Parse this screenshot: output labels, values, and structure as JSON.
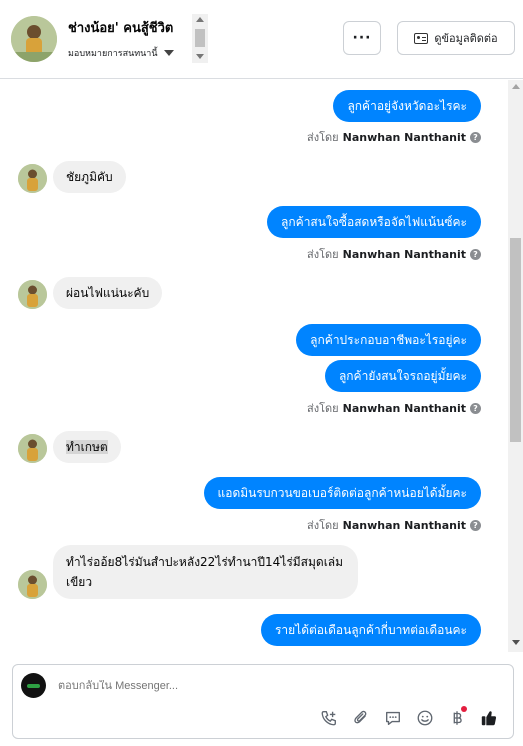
{
  "header": {
    "contact_name": "ช่างน้อย' คนสู้ชีวิต",
    "assign_label": "มอบหมายการสนทนานี้",
    "more_label": "···",
    "view_contact_label": "ดูข้อมูลติดต่อ"
  },
  "messages": [
    {
      "type": "out",
      "text": "ลูกค้าอยู่จังหวัดอะไรคะ"
    },
    {
      "type": "sent_by",
      "prefix": "ส่งโดย",
      "name": "Nanwhan Nanthanit"
    },
    {
      "type": "in",
      "text": "ชัยภูมิคับ"
    },
    {
      "type": "out",
      "text": "ลูกค้าสนใจซื้อสดหรือจัดไฟแน้นซ์คะ"
    },
    {
      "type": "sent_by",
      "prefix": "ส่งโดย",
      "name": "Nanwhan Nanthanit"
    },
    {
      "type": "in",
      "text": "ผ่อนไฟแน่นะคับ"
    },
    {
      "type": "out",
      "text": "ลูกค้าประกอบอาชีพอะไรอยู่คะ"
    },
    {
      "type": "out",
      "text": "ลูกค้ายังสนใจรถอยู่มั้ยคะ"
    },
    {
      "type": "sent_by",
      "prefix": "ส่งโดย",
      "name": "Nanwhan Nanthanit"
    },
    {
      "type": "in",
      "text": "ทำเกษต"
    },
    {
      "type": "out",
      "text": "แอดมินรบกวนขอเบอร์ติดต่อลูกค้าหน่อยได้มั้ยคะ"
    },
    {
      "type": "sent_by",
      "prefix": "ส่งโดย",
      "name": "Nanwhan Nanthanit"
    },
    {
      "type": "in",
      "text": "ทำไร่ออ้ย8ไร่มันสำปะหลัง22ไร่ทำนาปี14ไร่มีสมุดเล่มเขียว"
    },
    {
      "type": "out",
      "text": "รายได้ต่อเดือนลูกค้ากี่บาทต่อเดือนคะ"
    }
  ],
  "reply": {
    "placeholder": "ตอบกลับใน Messenger..."
  },
  "tools": [
    "phone-add-icon",
    "attachment-icon",
    "saved-reply-icon",
    "emoji-icon",
    "baht-payment-icon",
    "thumbs-up-icon"
  ],
  "colors": {
    "outgoing_bubble": "#0084ff",
    "incoming_bubble": "#f0f0f0",
    "notification_dot": "#e41e3f"
  }
}
